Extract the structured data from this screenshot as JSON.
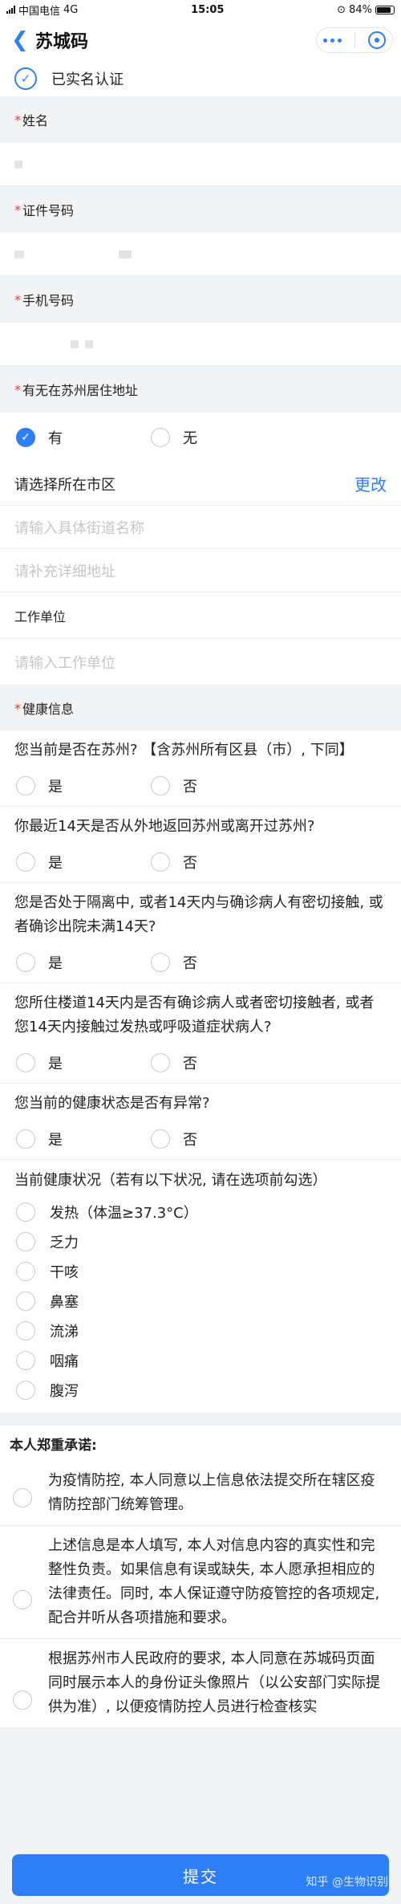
{
  "status": {
    "carrier": "中国电信",
    "network": "4G",
    "time": "15:05",
    "battery": "84%"
  },
  "nav": {
    "title": "苏城码"
  },
  "verified": {
    "text": "已实名认证"
  },
  "fields": {
    "name_label": "姓名",
    "id_label": "证件号码",
    "phone_label": "手机号码",
    "address_label": "有无在苏州居住地址",
    "address_yes": "有",
    "address_no": "无",
    "city_select": "请选择所在市区",
    "city_change": "更改",
    "street_placeholder": "请输入具体街道名称",
    "detail_placeholder": "请补充详细地址",
    "work_label": "工作单位",
    "work_placeholder": "请输入工作单位",
    "health_label": "健康信息"
  },
  "questions": [
    {
      "text": "您当前是否在苏州? 【含苏州所有区县（市）, 下同】",
      "yes": "是",
      "no": "否"
    },
    {
      "text": "你最近14天是否从外地返回苏州或离开过苏州?",
      "yes": "是",
      "no": "否"
    },
    {
      "text": "您是否处于隔离中, 或者14天内与确诊病人有密切接触, 或者确诊出院未满14天?",
      "yes": "是",
      "no": "否"
    },
    {
      "text": "您所住楼道14天内是否有确诊病人或者密切接触者, 或者您14天内接触过发热或呼吸道症状病人?",
      "yes": "是",
      "no": "否"
    },
    {
      "text": "您当前的健康状态是否有异常?",
      "yes": "是",
      "no": "否"
    }
  ],
  "symptoms": {
    "header": "当前健康状况（若有以下状况, 请在选项前勾选）",
    "items": [
      "发热（体温≥37.3°C）",
      "乏力",
      "干咳",
      "鼻塞",
      "流涕",
      "咽痛",
      "腹泻"
    ]
  },
  "promise": {
    "title": "本人郑重承诺:",
    "items": [
      "为疫情防控, 本人同意以上信息依法提交所在辖区疫情防控部门统筹管理。",
      "上述信息是本人填写, 本人对信息内容的真实性和完整性负责。如果信息有误或缺失, 本人愿承担相应的法律责任。同时, 本人保证遵守防疫管控的各项规定, 配合并听从各项措施和要求。",
      "根据苏州市人民政府的要求, 本人同意在苏城码页面同时展示本人的身份证头像照片（以公安部门实际提供为准）, 以便疫情防控人员进行检查核实"
    ]
  },
  "submit": {
    "label": "提交"
  },
  "watermark": "知乎 @生物识别"
}
